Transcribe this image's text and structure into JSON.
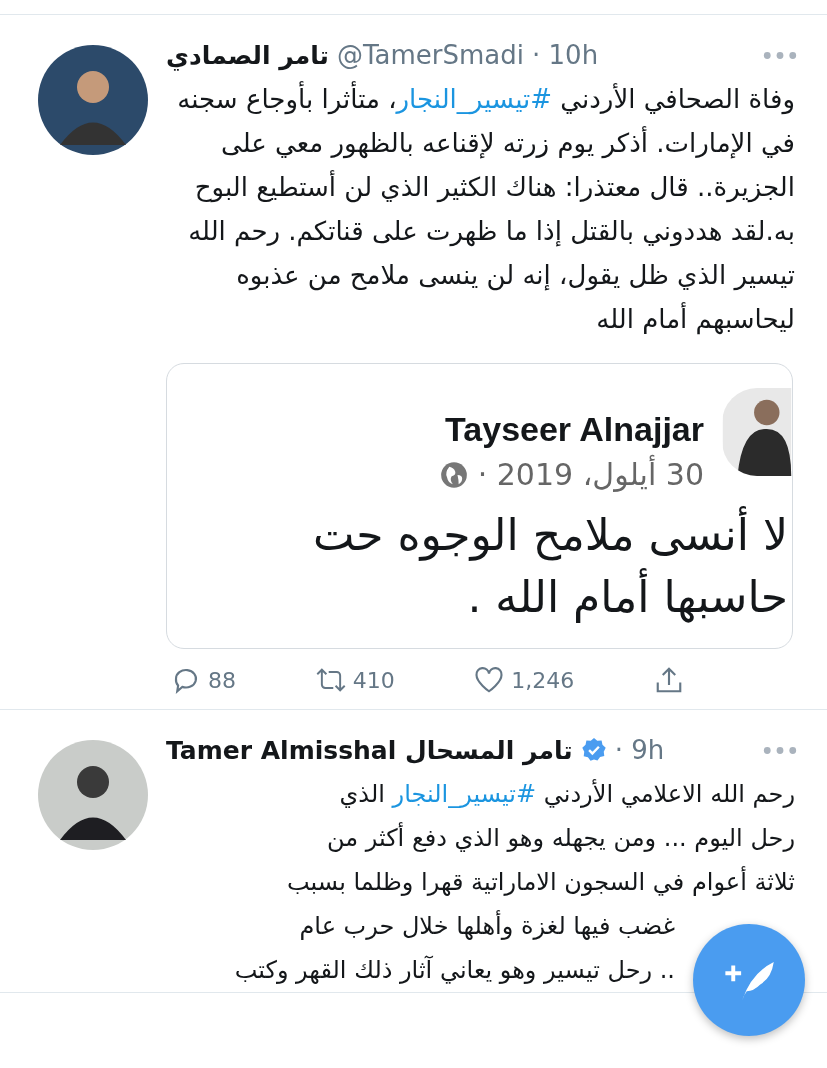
{
  "tweets": [
    {
      "name": "تامر الصمادي",
      "handle": "@TamerSmadi",
      "time": "· 10h",
      "text": [
        {
          "kind": "text",
          "s": "وفاة الصحافي الأردني "
        },
        {
          "kind": "hashtag",
          "s": "#تيسير_النجار"
        },
        {
          "kind": "text",
          "s": "، متأثرا بأوجاع سجنه في الإمارات. أذكر يوم زرته لإقناعه بالظهور معي على الجزيرة.. قال معتذرا: هناك الكثير الذي لن أستطيع البوح به.لقد هددوني بالقتل إذا ما ظهرت على قناتكم. رحم الله تيسير الذي ظل يقول، إنه لن ينسى ملامح من عذبوه ليحاسبهم أمام الله"
        }
      ],
      "card": {
        "name": "Tayseer Alnajjar",
        "date": "30 أيلول، 2019 ·",
        "lines": [
          "لا أنسى ملامح الوجوه حت",
          "حاسبها أمام الله ."
        ]
      },
      "actions": {
        "replies": "88",
        "retweets": "410",
        "likes": "1,246"
      }
    },
    {
      "name": "Tamer Almisshal تامر المسحال",
      "verified": true,
      "time": "· 9h",
      "lines": [
        [
          {
            "kind": "text",
            "s": "رحم الله الاعلامي الأردني  "
          },
          {
            "kind": "hashtag",
            "s": "#تيسير_النجار"
          },
          {
            "kind": "text",
            "s": " الذي"
          }
        ],
        [
          {
            "kind": "text",
            "s": "رحل اليوم  ... ومن يجهله وهو الذي دفع أكثر من"
          }
        ],
        [
          {
            "kind": "text",
            "s": "ثلاثة أعوام في السجون الاماراتية قهرا وظلما بسبب"
          }
        ],
        [
          {
            "kind": "text",
            "s": "غضب فيها لغزة وأهلها خلال حرب عام"
          }
        ],
        [
          {
            "kind": "text",
            "s": ".. رحل تيسير وهو يعاني آثار ذلك القهر وكتب"
          }
        ]
      ]
    }
  ]
}
